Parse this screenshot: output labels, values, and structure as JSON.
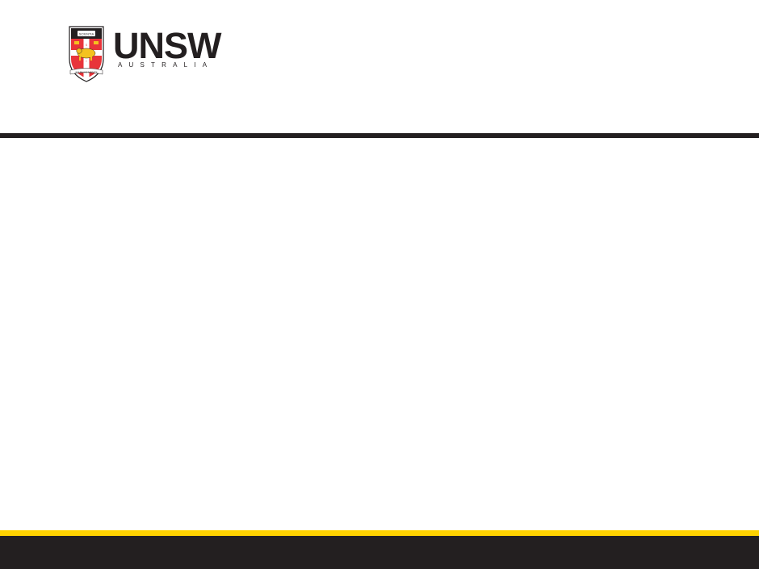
{
  "brand": {
    "wordmark": "UNSW",
    "subwordmark": "AUSTRALIA",
    "crest": {
      "book_text": "SCIENTIA",
      "scroll_text": "MANU ET MENTE",
      "book_letters": [
        "S",
        "C",
        "I",
        "E"
      ]
    }
  },
  "colors": {
    "text_dark": "#231f20",
    "footer_accent": "#ffd200",
    "footer_bar": "#231f20",
    "rule": "#231f20",
    "crest_red": "#e8343a",
    "crest_gold": "#f4c21f"
  },
  "icons": [
    "unsw-crest-icon",
    "lion-icon",
    "book-icon"
  ]
}
